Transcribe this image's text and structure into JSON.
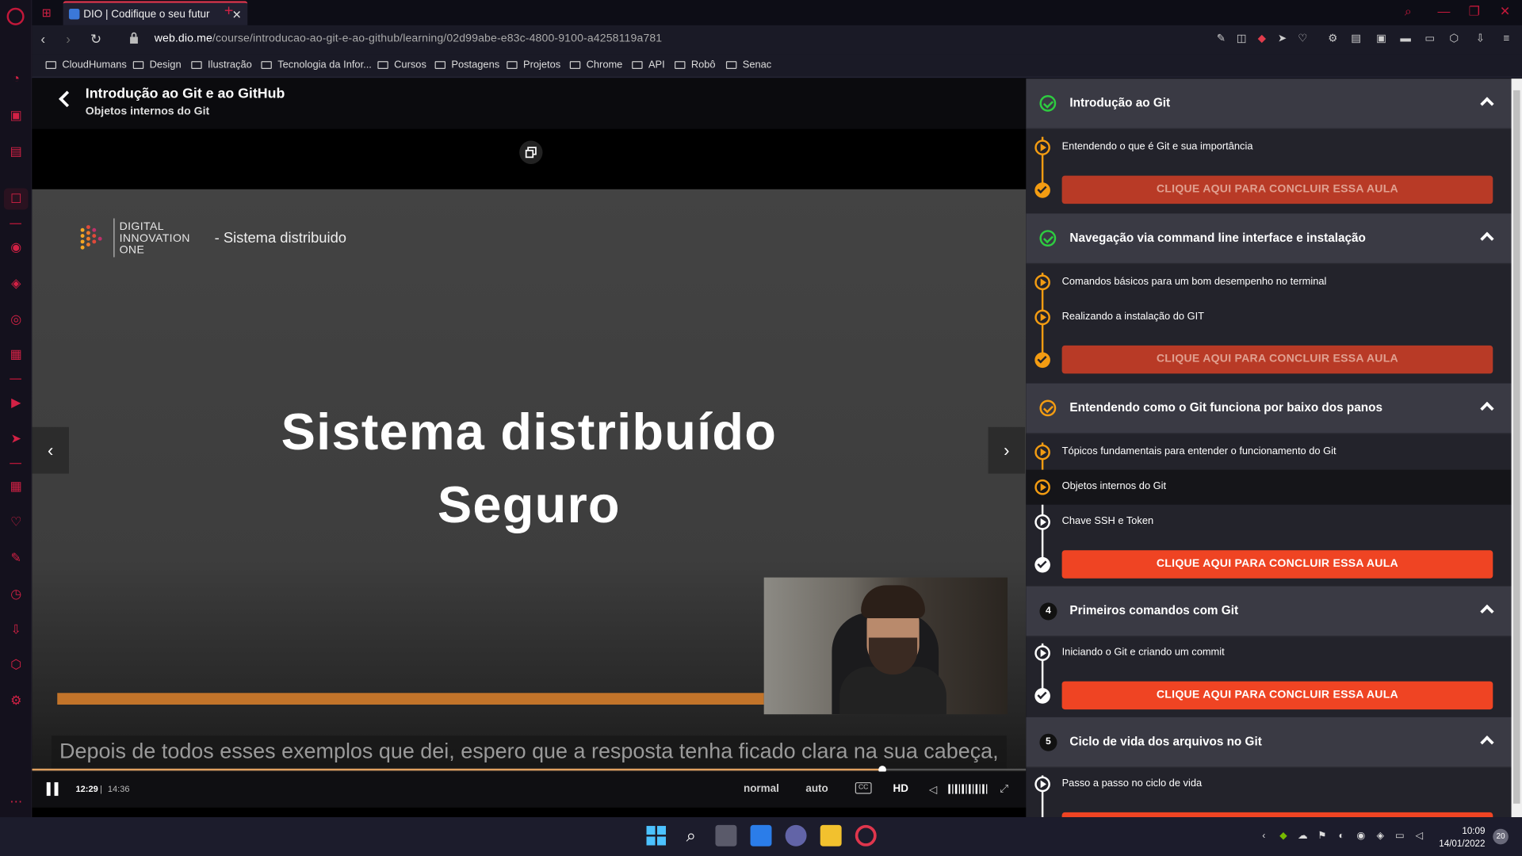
{
  "browser": {
    "tab_title": "DIO | Codifique o seu futur",
    "url_domain": "web.dio.me",
    "url_path": "/course/introducao-ao-git-e-ao-github/learning/02d99abe-e83c-4800-9100-a4258119a781",
    "bookmarks": [
      "CloudHumans",
      "Design",
      "Ilustração",
      "Tecnologia da Infor...",
      "Cursos",
      "Postagens",
      "Projetos",
      "Chrome",
      "API",
      "Robô",
      "Senac"
    ]
  },
  "course": {
    "title": "Introdução ao Git e ao GitHub",
    "current_lesson": "Objetos internos do Git"
  },
  "video": {
    "brand_lines": [
      "DIGITAL",
      "INNOVATION",
      "ONE"
    ],
    "slide_subtitle": "- Sistema distribuido",
    "slide_title_line1": "Sistema distribuído",
    "slide_title_line2": "Seguro",
    "caption": "Depois de todos esses exemplos que dei, espero que a resposta tenha ficado clara na sua cabeça,",
    "time_current": "12:29",
    "time_separator": "|",
    "time_total": "14:36",
    "progress_fraction": 0.855,
    "speed_label": "normal",
    "quality_label": "auto",
    "cc_label": "CC",
    "hd_label": "HD"
  },
  "sections": [
    {
      "title": "Introdução ao Git",
      "status": "done",
      "items": [
        "Entendendo o que é Git e sua importância"
      ],
      "complete_label": "CLIQUE AQUI PARA CONCLUIR ESSA AULA"
    },
    {
      "title": "Navegação via command line interface e instalação",
      "status": "done",
      "items": [
        "Comandos básicos para um bom desempenho no terminal",
        "Realizando a instalação do GIT"
      ],
      "complete_label": "CLIQUE AQUI PARA CONCLUIR ESSA AULA"
    },
    {
      "title": "Entendendo como o Git funciona por baixo dos panos",
      "status": "in-progress",
      "items": [
        "Tópicos fundamentais para entender o funcionamento do Git",
        "Objetos internos do Git",
        "Chave SSH e Token"
      ],
      "complete_label": "CLIQUE AQUI PARA CONCLUIR ESSA AULA"
    },
    {
      "number": "4",
      "title": "Primeiros comandos com Git",
      "items": [
        "Iniciando o Git e criando um commit"
      ],
      "complete_label": "CLIQUE AQUI PARA CONCLUIR ESSA AULA"
    },
    {
      "number": "5",
      "title": "Ciclo de vida dos arquivos no Git",
      "items": [
        "Passo a passo no ciclo de vida"
      ]
    }
  ],
  "taskbar": {
    "time": "10:09",
    "date": "14/01/2022",
    "notification_count": "20"
  },
  "colors": {
    "accent_orange": "#f39c12",
    "done_green": "#2ecc40",
    "cta_red": "#ef4423",
    "opera_red": "#d32145"
  }
}
